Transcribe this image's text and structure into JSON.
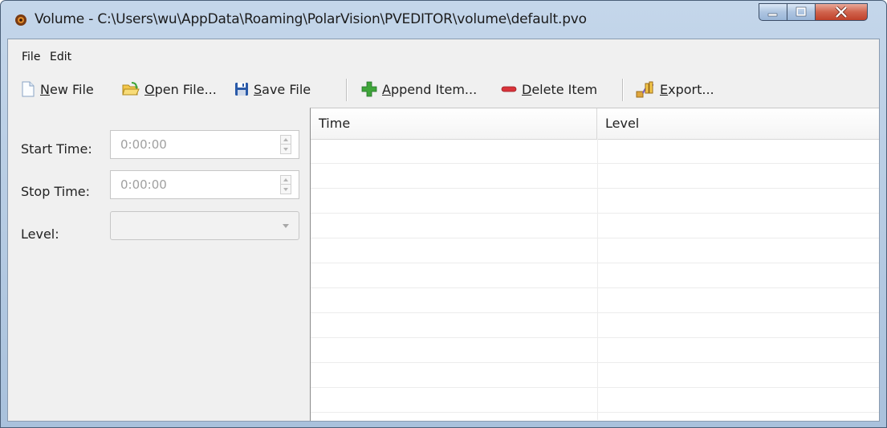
{
  "window": {
    "title": "Volume - C:\\Users\\wu\\AppData\\Roaming\\PolarVision\\PVEDITOR\\volume\\default.pvo"
  },
  "menu": {
    "items": [
      "File",
      "Edit"
    ]
  },
  "toolbar": {
    "new_file": {
      "mnemonic": "N",
      "rest": "ew File"
    },
    "open_file": {
      "mnemonic": "O",
      "rest": "pen File..."
    },
    "save_file": {
      "mnemonic": "S",
      "rest": "ave File"
    },
    "append_item": {
      "mnemonic": "A",
      "rest": "ppend Item..."
    },
    "delete_item": {
      "mnemonic": "D",
      "rest": "elete Item"
    },
    "export": {
      "mnemonic": "E",
      "rest": "xport..."
    }
  },
  "form": {
    "start_time_label": "Start Time:",
    "start_time_value": "0:00:00",
    "stop_time_label": "Stop Time:",
    "stop_time_value": "0:00:00",
    "level_label": "Level:",
    "level_value": ""
  },
  "table": {
    "columns": [
      "Time",
      "Level"
    ],
    "rows": []
  },
  "colors": {
    "append_icon": "#3fa53a",
    "delete_icon": "#d8333a",
    "save_icon": "#2a5aa8"
  },
  "icons": [
    "app-icon",
    "new-file-icon",
    "open-folder-icon",
    "save-disk-icon",
    "plus-icon",
    "minus-icon",
    "export-icon"
  ]
}
